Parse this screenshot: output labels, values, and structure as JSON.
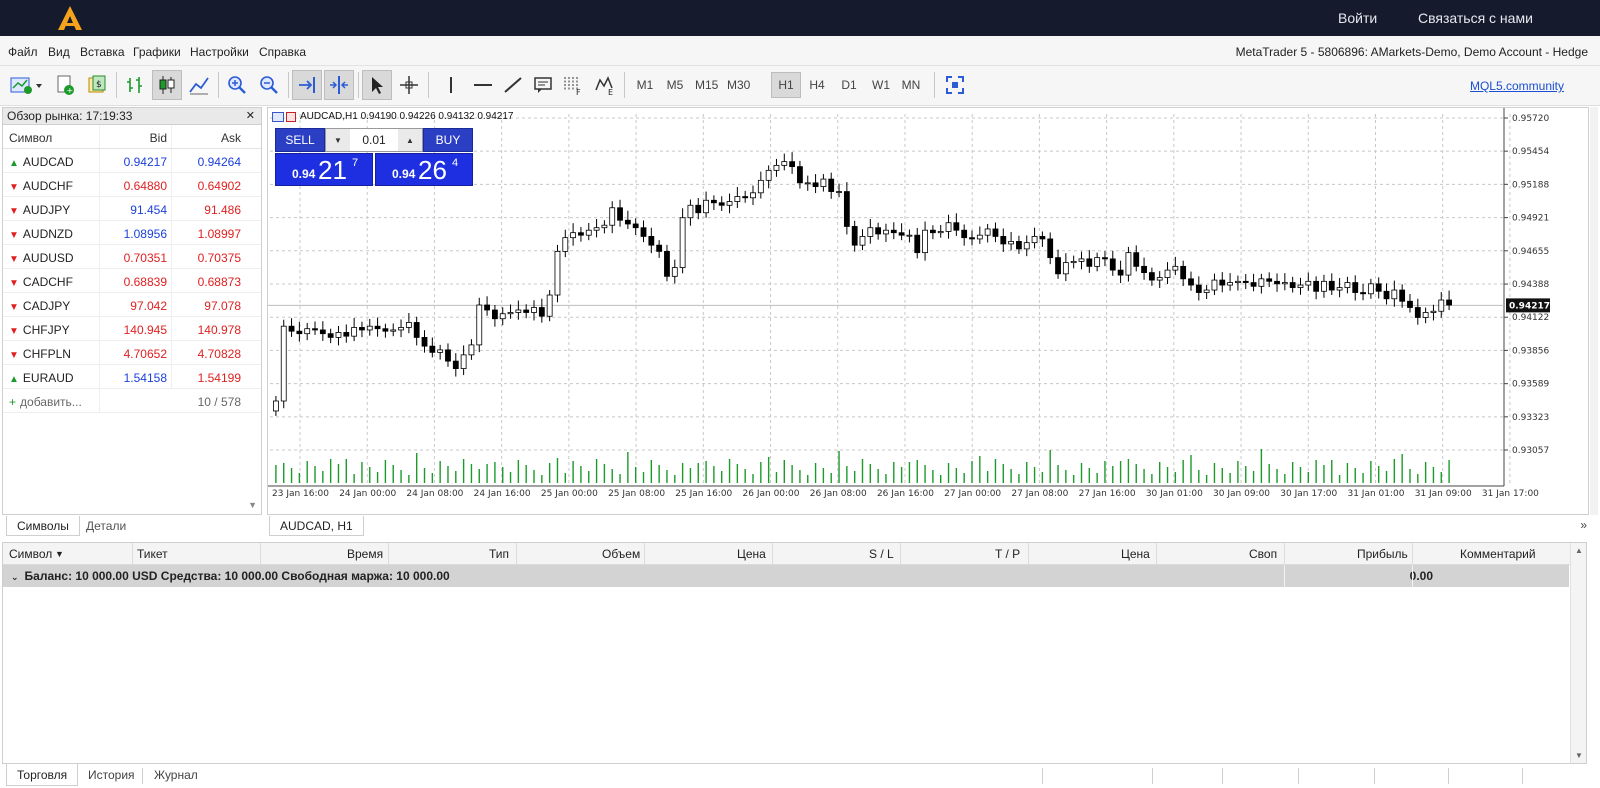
{
  "brand": {
    "login": "Войти",
    "contact": "Связаться с нами",
    "accent": "#f5a21c"
  },
  "menu": {
    "items": [
      "Файл",
      "Вид",
      "Вставка",
      "Графики",
      "Настройки",
      "Справка"
    ],
    "account_info": "MetaTrader 5 - 5806896: AMarkets-Demo, Demo Account - Hedge"
  },
  "toolbar": {
    "timeframes": [
      "M1",
      "M5",
      "M15",
      "M30",
      "H1",
      "H4",
      "D1",
      "W1",
      "MN"
    ],
    "active_timeframe": "H1",
    "mql_link": "MQL5.community",
    "icons": [
      "new-chart-icon",
      "new-order-icon",
      "algo-trading-icon",
      "bar-chart-icon",
      "candlestick-icon",
      "line-chart-icon",
      "zoom-in-icon",
      "zoom-out-icon",
      "autoscroll-icon",
      "chart-shift-icon",
      "cursor-icon",
      "crosshair-icon",
      "vertical-line-icon",
      "horizontal-line-icon",
      "trendline-icon",
      "text-icon",
      "fibonacci-icon",
      "elliott-icon",
      "fullscreen-icon"
    ]
  },
  "market_watch": {
    "title": "Обзор рынка: 17:19:33",
    "headers": {
      "symbol": "Символ",
      "bid": "Bid",
      "ask": "Ask"
    },
    "rows": [
      {
        "symbol": "AUDCAD",
        "bid": "0.94217",
        "ask": "0.94264",
        "dir": "up",
        "bid_color": "blue",
        "ask_color": "blue"
      },
      {
        "symbol": "AUDCHF",
        "bid": "0.64880",
        "ask": "0.64902",
        "dir": "down",
        "bid_color": "red",
        "ask_color": "red"
      },
      {
        "symbol": "AUDJPY",
        "bid": "91.454",
        "ask": "91.486",
        "dir": "down",
        "bid_color": "blue",
        "ask_color": "red"
      },
      {
        "symbol": "AUDNZD",
        "bid": "1.08956",
        "ask": "1.08997",
        "dir": "down",
        "bid_color": "blue",
        "ask_color": "red"
      },
      {
        "symbol": "AUDUSD",
        "bid": "0.70351",
        "ask": "0.70375",
        "dir": "down",
        "bid_color": "red",
        "ask_color": "red"
      },
      {
        "symbol": "CADCHF",
        "bid": "0.68839",
        "ask": "0.68873",
        "dir": "down",
        "bid_color": "red",
        "ask_color": "red"
      },
      {
        "symbol": "CADJPY",
        "bid": "97.042",
        "ask": "97.078",
        "dir": "down",
        "bid_color": "red",
        "ask_color": "red"
      },
      {
        "symbol": "CHFJPY",
        "bid": "140.945",
        "ask": "140.978",
        "dir": "down",
        "bid_color": "red",
        "ask_color": "red"
      },
      {
        "symbol": "CHFPLN",
        "bid": "4.70652",
        "ask": "4.70828",
        "dir": "down",
        "bid_color": "red",
        "ask_color": "red"
      },
      {
        "symbol": "EURAUD",
        "bid": "1.54158",
        "ask": "1.54199",
        "dir": "up",
        "bid_color": "blue",
        "ask_color": "red"
      }
    ],
    "add_label": "добавить...",
    "count": "10 / 578",
    "tabs": [
      "Символы",
      "Детали"
    ]
  },
  "chart": {
    "header": "AUDCAD,H1  0.94190 0.94226 0.94132 0.94217",
    "tab": "AUDCAD, H1",
    "sell_label": "SELL",
    "buy_label": "BUY",
    "lot": "0.01",
    "sell_price": {
      "prefix": "0.94",
      "big": "21",
      "sup": "7"
    },
    "buy_price": {
      "prefix": "0.94",
      "big": "26",
      "sup": "4"
    },
    "current_price": "0.94217",
    "up_color": "#ffffff",
    "down_color": "#000000",
    "volume_color": "#1c9a2a"
  },
  "chart_data": {
    "type": "candlestick",
    "title": "AUDCAD,H1",
    "y_ticks": [
      "0.95720",
      "0.95454",
      "0.95188",
      "0.94921",
      "0.94655",
      "0.94388",
      "0.94122",
      "0.93856",
      "0.93589",
      "0.93323",
      "0.93057"
    ],
    "ylim": [
      0.93057,
      0.9572
    ],
    "x_ticks": [
      "23 Jan 16:00",
      "24 Jan 00:00",
      "24 Jan 08:00",
      "24 Jan 16:00",
      "25 Jan 00:00",
      "25 Jan 08:00",
      "25 Jan 16:00",
      "26 Jan 00:00",
      "26 Jan 08:00",
      "26 Jan 16:00",
      "27 Jan 00:00",
      "27 Jan 08:00",
      "27 Jan 16:00",
      "30 Jan 01:00",
      "30 Jan 09:00",
      "30 Jan 17:00",
      "31 Jan 01:00",
      "31 Jan 09:00",
      "31 Jan 17:00"
    ],
    "close": [
      0.9345,
      0.9405,
      0.9401,
      0.9399,
      0.9403,
      0.9402,
      0.9399,
      0.9396,
      0.94,
      0.9397,
      0.9404,
      0.9402,
      0.9405,
      0.9403,
      0.9401,
      0.9402,
      0.9404,
      0.9408,
      0.9396,
      0.9389,
      0.9384,
      0.9386,
      0.9377,
      0.9371,
      0.9382,
      0.939,
      0.9422,
      0.9418,
      0.9411,
      0.9415,
      0.9416,
      0.9418,
      0.9416,
      0.942,
      0.9413,
      0.943,
      0.9465,
      0.9476,
      0.948,
      0.9478,
      0.9482,
      0.9484,
      0.9486,
      0.95,
      0.949,
      0.9487,
      0.9484,
      0.9477,
      0.947,
      0.9465,
      0.9445,
      0.9452,
      0.9492,
      0.9502,
      0.9496,
      0.9506,
      0.9504,
      0.9502,
      0.9505,
      0.9509,
      0.9508,
      0.9512,
      0.9522,
      0.953,
      0.9534,
      0.9537,
      0.9533,
      0.952,
      0.952,
      0.9517,
      0.9523,
      0.9513,
      0.9513,
      0.9485,
      0.947,
      0.9477,
      0.9484,
      0.9479,
      0.9482,
      0.948,
      0.9478,
      0.9478,
      0.9464,
      0.9482,
      0.948,
      0.9481,
      0.9488,
      0.9482,
      0.9476,
      0.9475,
      0.9478,
      0.9483,
      0.9477,
      0.9471,
      0.9473,
      0.9467,
      0.9472,
      0.9477,
      0.9475,
      0.946,
      0.9447,
      0.9456,
      0.9457,
      0.9459,
      0.9453,
      0.946,
      0.9459,
      0.945,
      0.9446,
      0.9464,
      0.9453,
      0.9448,
      0.9442,
      0.9444,
      0.945,
      0.9453,
      0.9443,
      0.9438,
      0.9432,
      0.9434,
      0.9442,
      0.9438,
      0.944,
      0.9441,
      0.944,
      0.9437,
      0.9443,
      0.9441,
      0.9439,
      0.944,
      0.9436,
      0.9438,
      0.9441,
      0.9433,
      0.9441,
      0.9434,
      0.9436,
      0.944,
      0.9432,
      0.9431,
      0.9439,
      0.9433,
      0.9427,
      0.9434,
      0.9425,
      0.942,
      0.9412,
      0.9416,
      0.9417,
      0.9426,
      0.9422
    ]
  },
  "terminal": {
    "headers": [
      "Символ",
      "Тикет",
      "Время",
      "Тип",
      "Объем",
      "Цена",
      "S / L",
      "T / P",
      "Цена",
      "Своп",
      "Прибыль",
      "Комментарий"
    ],
    "balance_text": "Баланс: 10 000.00 USD  Средства: 10 000.00  Свободная маржа: 10 000.00",
    "profit": "0.00",
    "tabs": [
      "Торговля",
      "История",
      "Журнал"
    ]
  }
}
